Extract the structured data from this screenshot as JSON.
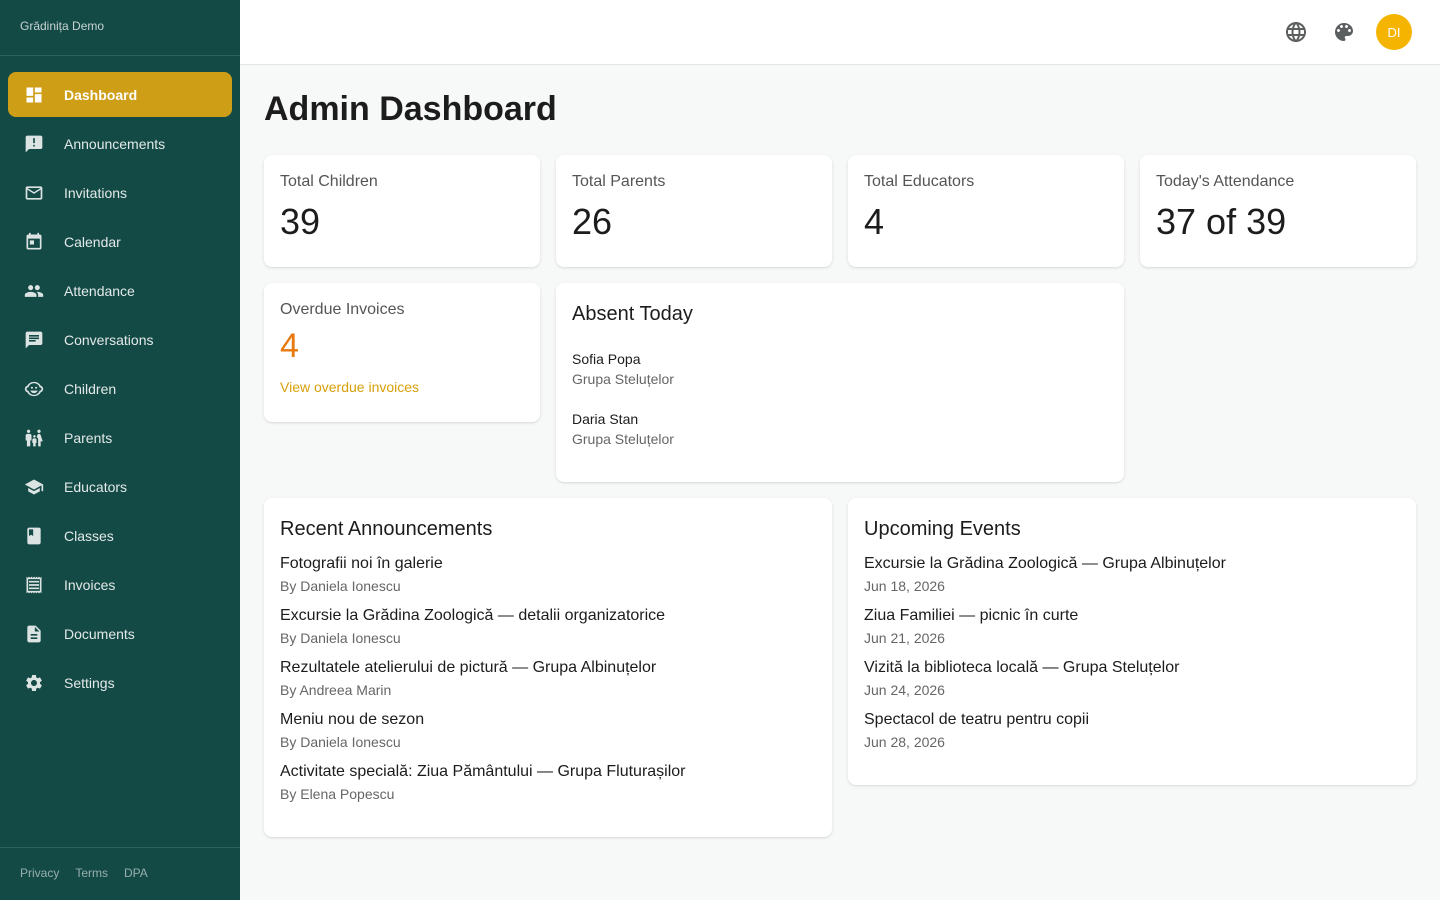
{
  "app": {
    "brand": "Grădinița Demo"
  },
  "sidebar": {
    "items": [
      {
        "label": "Dashboard",
        "icon": "dashboard-icon",
        "active": true
      },
      {
        "label": "Announcements",
        "icon": "announcement-icon"
      },
      {
        "label": "Invitations",
        "icon": "mail-icon"
      },
      {
        "label": "Calendar",
        "icon": "calendar-icon"
      },
      {
        "label": "Attendance",
        "icon": "people-icon"
      },
      {
        "label": "Conversations",
        "icon": "chat-icon"
      },
      {
        "label": "Children",
        "icon": "child-face-icon"
      },
      {
        "label": "Parents",
        "icon": "family-icon"
      },
      {
        "label": "Educators",
        "icon": "school-icon"
      },
      {
        "label": "Classes",
        "icon": "book-icon"
      },
      {
        "label": "Invoices",
        "icon": "receipt-icon"
      },
      {
        "label": "Documents",
        "icon": "document-icon"
      },
      {
        "label": "Settings",
        "icon": "gear-icon"
      }
    ],
    "footer": {
      "privacy": "Privacy",
      "terms": "Terms",
      "dpa": "DPA"
    }
  },
  "topbar": {
    "icons": [
      "globe-icon",
      "palette-icon"
    ],
    "avatar_initials": "DI"
  },
  "page": {
    "title": "Admin Dashboard"
  },
  "stats": {
    "total_children": {
      "label": "Total Children",
      "value": "39"
    },
    "total_parents": {
      "label": "Total Parents",
      "value": "26"
    },
    "total_educators": {
      "label": "Total Educators",
      "value": "4"
    },
    "attendance": {
      "label": "Today's Attendance",
      "value": "37 of 39"
    },
    "overdue": {
      "label": "Overdue Invoices",
      "value": "4",
      "link": "View overdue invoices"
    }
  },
  "absent": {
    "title": "Absent Today",
    "items": [
      {
        "name": "Sofia Popa",
        "group": "Grupa Steluțelor"
      },
      {
        "name": "Daria Stan",
        "group": "Grupa Steluțelor"
      }
    ]
  },
  "announcements": {
    "title": "Recent Announcements",
    "items": [
      {
        "title": "Fotografii noi în galerie",
        "by": "By Daniela Ionescu"
      },
      {
        "title": "Excursie la Grădina Zoologică — detalii organizatorice",
        "by": "By Daniela Ionescu"
      },
      {
        "title": "Rezultatele atelierului de pictură — Grupa Albinuțelor",
        "by": "By Andreea Marin"
      },
      {
        "title": "Meniu nou de sezon",
        "by": "By Daniela Ionescu"
      },
      {
        "title": "Activitate specială: Ziua Pământului — Grupa Fluturașilor",
        "by": "By Elena Popescu"
      }
    ]
  },
  "events": {
    "title": "Upcoming Events",
    "items": [
      {
        "title": "Excursie la Grădina Zoologică — Grupa Albinuțelor",
        "date": "Jun 18, 2026"
      },
      {
        "title": "Ziua Familiei — picnic în curte",
        "date": "Jun 21, 2026"
      },
      {
        "title": "Vizită la biblioteca locală — Grupa Steluțelor",
        "date": "Jun 24, 2026"
      },
      {
        "title": "Spectacol de teatru pentru copii",
        "date": "Jun 28, 2026"
      }
    ]
  },
  "colors": {
    "sidebar": "#144a46",
    "accent": "#cf9e17",
    "warning": "#e8790c",
    "avatar": "#f4b400"
  }
}
